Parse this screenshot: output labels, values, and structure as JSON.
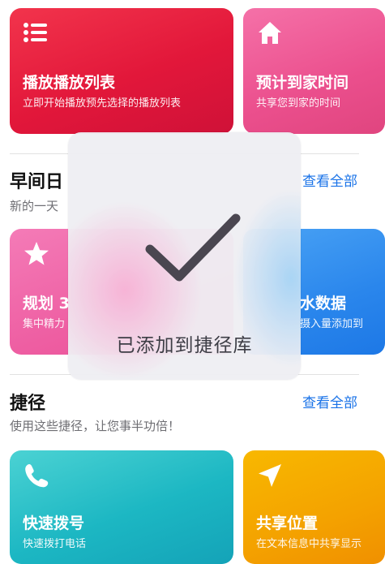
{
  "cards_row1": {
    "playlist": {
      "icon": "list-icon",
      "title": "播放播放列表",
      "subtitle": "立即开始播放预先选择的播放列表"
    },
    "arrival": {
      "icon": "home-icon",
      "title": "预计到家时间",
      "subtitle": "共享您到家的时间"
    }
  },
  "section_morning": {
    "title": "早间日",
    "subtitle": "新的一天",
    "see_all": "查看全部"
  },
  "cards_row2": {
    "plan": {
      "icon": "star-icon",
      "title": "规划 3",
      "subtitle": "集中精力"
    },
    "water": {
      "icon": "water-icon",
      "title": "水数据",
      "subtitle": "摄入量添加到"
    }
  },
  "section_shortcuts": {
    "title": "捷径",
    "subtitle": "使用这些捷径，让您事半功倍！",
    "see_all": "查看全部"
  },
  "cards_row3": {
    "dial": {
      "icon": "phone-icon",
      "title": "快速拨号",
      "subtitle": "快速拨打电话"
    },
    "location": {
      "icon": "location-arrow-icon",
      "title": "共享位置",
      "subtitle": "在文本信息中共享显示"
    }
  },
  "toast": {
    "icon": "checkmark-icon",
    "message": "已添加到捷径库"
  },
  "colors": {
    "accent_link": "#1a73e8",
    "playlist_card": "#e2173a",
    "arrival_card": "#eb4f8d",
    "plan_card": "#ee5ea2",
    "water_card": "#2a86ec",
    "dial_card": "#1cb7c3",
    "location_card": "#f4a200"
  }
}
